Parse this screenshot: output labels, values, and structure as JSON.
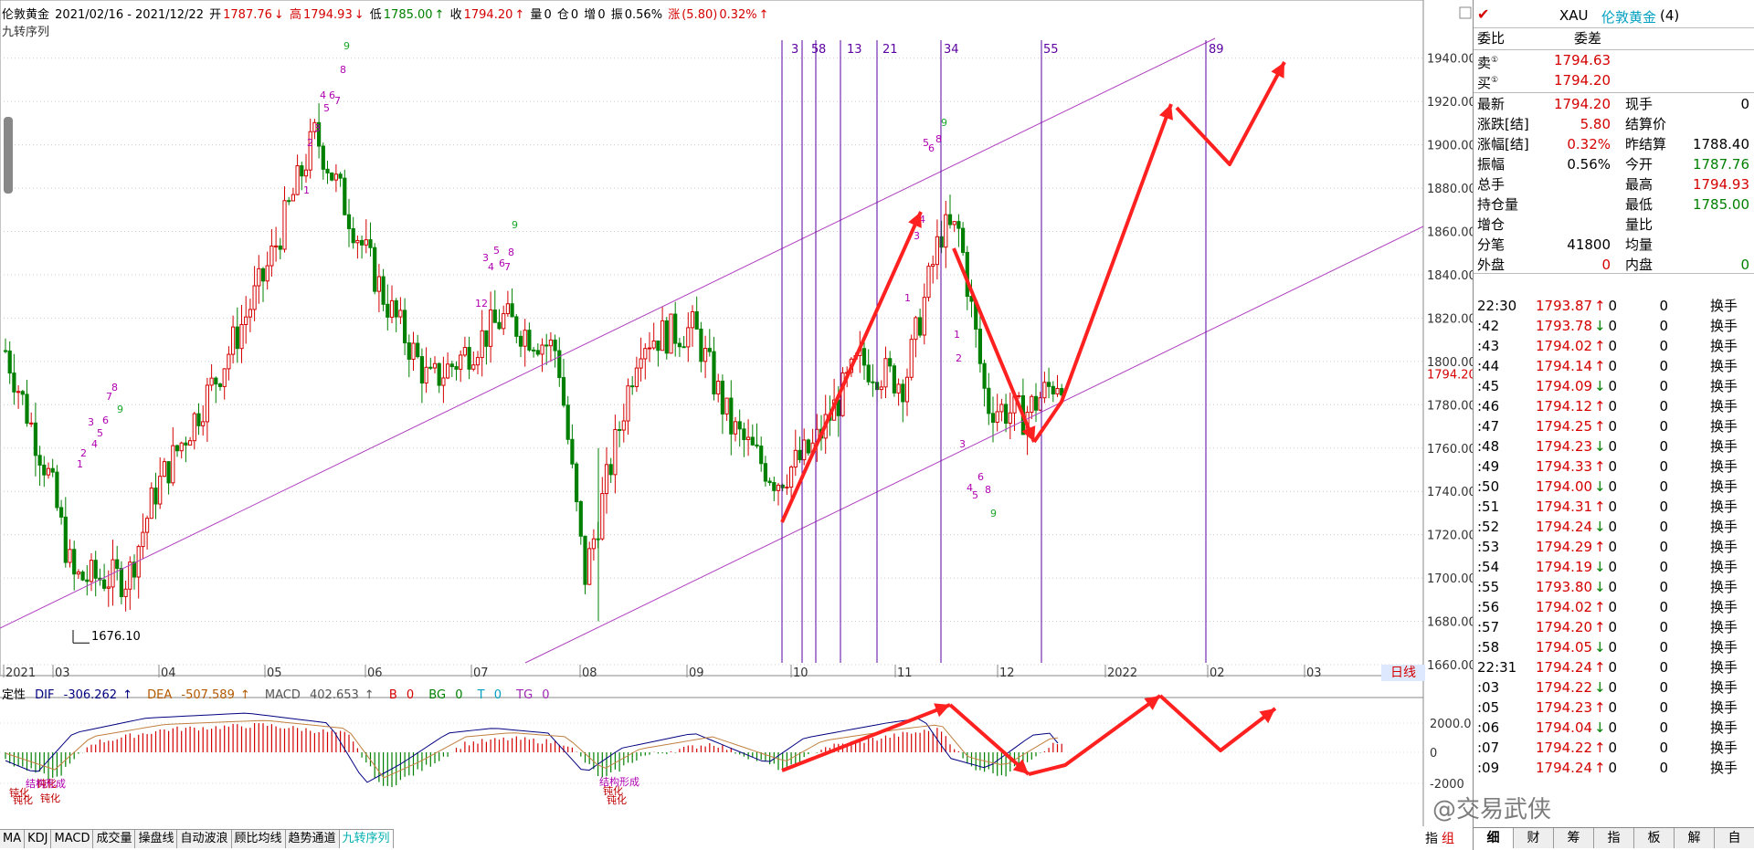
{
  "header": {
    "name": "伦敦黄金",
    "range": "2021/02/16 - 2021/12/22",
    "open_label": "开",
    "open": "1787.76",
    "open_arrow": "↓",
    "high_label": "高",
    "high": "1794.93",
    "high_arrow": "↓",
    "low_label": "低",
    "low": "1785.00",
    "low_arrow": "↑",
    "close_label": "收",
    "close": "1794.20",
    "close_arrow": "↑",
    "vol_label": "量",
    "vol": "0",
    "pos_label": "仓",
    "pos": "0",
    "inc_label": "增",
    "inc": "0",
    "amp_label": "振",
    "amp": "0.56%",
    "chg_label": "涨",
    "chg": "(5.80)",
    "chg_pct": "0.32%",
    "chg_arrow": "↑"
  },
  "subtitle": "九转序列",
  "main_chart": {
    "y_ticks": [
      "1940.00",
      "1920.00",
      "1900.00",
      "1880.00",
      "1860.00",
      "1840.00",
      "1820.00",
      "1800.00",
      "1780.00",
      "1760.00",
      "1740.00",
      "1720.00",
      "1700.00",
      "1680.00",
      "1660.00"
    ],
    "current_price": "1794.20",
    "x_ticks": [
      "2021",
      "03",
      "04",
      "05",
      "06",
      "07",
      "08",
      "09",
      "10",
      "11",
      "12",
      "2022",
      "02",
      "03"
    ],
    "low_annotation": "1676.10",
    "fib_labels": [
      "3",
      "5",
      "8",
      "13",
      "21",
      "34",
      "55",
      "89"
    ],
    "day_button": "日线"
  },
  "chart_data": [
    {
      "type": "candlestick",
      "title": "伦敦黄金",
      "ylim": [
        1660,
        1950
      ],
      "x_ticks": [
        "2021",
        "03",
        "04",
        "05",
        "06",
        "07",
        "08",
        "09",
        "10",
        "11",
        "12",
        "2022",
        "02",
        "03"
      ],
      "annotations": [
        "1676.10",
        "九转序列 1-9 counts",
        "Fibonacci time lines 3,5,8,13,21,34,55,89",
        "rising channel",
        "forecast arrows"
      ],
      "current_price": 1794.2
    },
    {
      "type": "bar",
      "title": "MACD",
      "y_ticks": [
        "2000.0",
        "0",
        "-2000"
      ],
      "series": [
        {
          "name": "DIF",
          "value": -306.262
        },
        {
          "name": "DEA",
          "value": -507.589
        },
        {
          "name": "MACD",
          "value": 402.653
        }
      ]
    }
  ],
  "indicator": {
    "prefix": "定性",
    "dif_label": "DIF",
    "dif": "-306.262",
    "dif_arrow": "↑",
    "dea_label": "DEA",
    "dea": "-507.589",
    "dea_arrow": "↑",
    "macd_label": "MACD",
    "macd": "402.653",
    "macd_arrow": "↑",
    "b_label": "B",
    "b": "0",
    "bg_label": "BG",
    "bg": "0",
    "t_label": "T",
    "t": "0",
    "tg_label": "TG",
    "tg": "0",
    "y_ticks": [
      "2000.0",
      "0",
      "-2000"
    ],
    "annotations": [
      "钝化",
      "钝化",
      "钝化",
      "钝化",
      "结构形成",
      "钝化",
      "结构形成",
      "钝化"
    ]
  },
  "tabs": [
    "MA",
    "KDJ",
    "MACD",
    "成交量",
    "操盘线",
    "自动波浪",
    "顾比均线",
    "趋势通道",
    "九转序列"
  ],
  "panel": {
    "symbol": "XAU",
    "symbol_name": "伦敦黄金",
    "symbol_count": "(4)",
    "weibi_label": "委比",
    "weicha_label": "委差",
    "sell_label": "卖",
    "sell_price": "1794.63",
    "buy_label": "买",
    "buy_price": "1794.20",
    "stats": [
      {
        "l": "最新",
        "v": "1794.20",
        "l2": "现手",
        "v2": "0",
        "c": "red",
        "c2": "black"
      },
      {
        "l": "涨跌[结]",
        "v": "5.80",
        "l2": "结算价",
        "v2": "",
        "c": "red",
        "c2": "black"
      },
      {
        "l": "涨幅[结]",
        "v": "0.32%",
        "l2": "昨结算",
        "v2": "1788.40",
        "c": "red",
        "c2": "black"
      },
      {
        "l": "振幅",
        "v": "0.56%",
        "l2": "今开",
        "v2": "1787.76",
        "c": "black",
        "c2": "green"
      },
      {
        "l": "总手",
        "v": "",
        "l2": "最高",
        "v2": "1794.93",
        "c": "black",
        "c2": "red"
      },
      {
        "l": "持仓量",
        "v": "",
        "l2": "最低",
        "v2": "1785.00",
        "c": "black",
        "c2": "green"
      },
      {
        "l": "增仓",
        "v": "",
        "l2": "量比",
        "v2": "",
        "c": "black",
        "c2": "black"
      },
      {
        "l": "分笔",
        "v": "41800",
        "l2": "均量",
        "v2": "",
        "c": "black",
        "c2": "black"
      },
      {
        "l": "外盘",
        "v": "0",
        "l2": "内盘",
        "v2": "0",
        "c": "red",
        "c2": "green"
      }
    ],
    "ticks": [
      {
        "t": "22:30",
        "p": "1793.87",
        "a": "↑",
        "v": "0",
        "n": "0",
        "s": "换手",
        "ac": "red"
      },
      {
        "t": ":42",
        "p": "1793.78",
        "a": "↓",
        "v": "0",
        "n": "0",
        "s": "换手",
        "ac": "green"
      },
      {
        "t": ":43",
        "p": "1794.02",
        "a": "↑",
        "v": "0",
        "n": "0",
        "s": "换手",
        "ac": "red"
      },
      {
        "t": ":44",
        "p": "1794.14",
        "a": "↑",
        "v": "0",
        "n": "0",
        "s": "换手",
        "ac": "red"
      },
      {
        "t": ":45",
        "p": "1794.09",
        "a": "↓",
        "v": "0",
        "n": "0",
        "s": "换手",
        "ac": "green"
      },
      {
        "t": ":46",
        "p": "1794.12",
        "a": "↑",
        "v": "0",
        "n": "0",
        "s": "换手",
        "ac": "red"
      },
      {
        "t": ":47",
        "p": "1794.25",
        "a": "↑",
        "v": "0",
        "n": "0",
        "s": "换手",
        "ac": "red"
      },
      {
        "t": ":48",
        "p": "1794.23",
        "a": "↓",
        "v": "0",
        "n": "0",
        "s": "换手",
        "ac": "green"
      },
      {
        "t": ":49",
        "p": "1794.33",
        "a": "↑",
        "v": "0",
        "n": "0",
        "s": "换手",
        "ac": "red"
      },
      {
        "t": ":50",
        "p": "1794.00",
        "a": "↓",
        "v": "0",
        "n": "0",
        "s": "换手",
        "ac": "green"
      },
      {
        "t": ":51",
        "p": "1794.31",
        "a": "↑",
        "v": "0",
        "n": "0",
        "s": "换手",
        "ac": "red"
      },
      {
        "t": ":52",
        "p": "1794.24",
        "a": "↓",
        "v": "0",
        "n": "0",
        "s": "换手",
        "ac": "green"
      },
      {
        "t": ":53",
        "p": "1794.29",
        "a": "↑",
        "v": "0",
        "n": "0",
        "s": "换手",
        "ac": "red"
      },
      {
        "t": ":54",
        "p": "1794.19",
        "a": "↓",
        "v": "0",
        "n": "0",
        "s": "换手",
        "ac": "green"
      },
      {
        "t": ":55",
        "p": "1793.80",
        "a": "↓",
        "v": "0",
        "n": "0",
        "s": "换手",
        "ac": "green"
      },
      {
        "t": ":56",
        "p": "1794.02",
        "a": "↑",
        "v": "0",
        "n": "0",
        "s": "换手",
        "ac": "red"
      },
      {
        "t": ":57",
        "p": "1794.20",
        "a": "↑",
        "v": "0",
        "n": "0",
        "s": "换手",
        "ac": "red"
      },
      {
        "t": ":58",
        "p": "1794.05",
        "a": "↓",
        "v": "0",
        "n": "0",
        "s": "换手",
        "ac": "green"
      },
      {
        "t": "22:31",
        "p": "1794.24",
        "a": "↑",
        "v": "0",
        "n": "0",
        "s": "换手",
        "ac": "red"
      },
      {
        "t": ":03",
        "p": "1794.22",
        "a": "↓",
        "v": "0",
        "n": "0",
        "s": "换手",
        "ac": "green"
      },
      {
        "t": ":05",
        "p": "1794.23",
        "a": "↑",
        "v": "0",
        "n": "0",
        "s": "换手",
        "ac": "red"
      },
      {
        "t": ":06",
        "p": "1794.04",
        "a": "↓",
        "v": "0",
        "n": "0",
        "s": "换手",
        "ac": "green"
      },
      {
        "t": ":07",
        "p": "1794.22",
        "a": "↑",
        "v": "0",
        "n": "0",
        "s": "换手",
        "ac": "red"
      },
      {
        "t": ":09",
        "p": "1794.24",
        "a": "↑",
        "v": "0",
        "n": "0",
        "s": "换手",
        "ac": "red"
      }
    ],
    "bottom_tabs": [
      "细",
      "财",
      "筹",
      "指",
      "板",
      "解",
      "自"
    ],
    "left_bottom_tabs": [
      "指",
      "组"
    ]
  },
  "watermark": "@交易武侠",
  "colors": {
    "up": "#d40000",
    "down": "#008000",
    "channel": "#b040c0",
    "fib": "#5a00a0",
    "arrow": "#ff2020"
  }
}
